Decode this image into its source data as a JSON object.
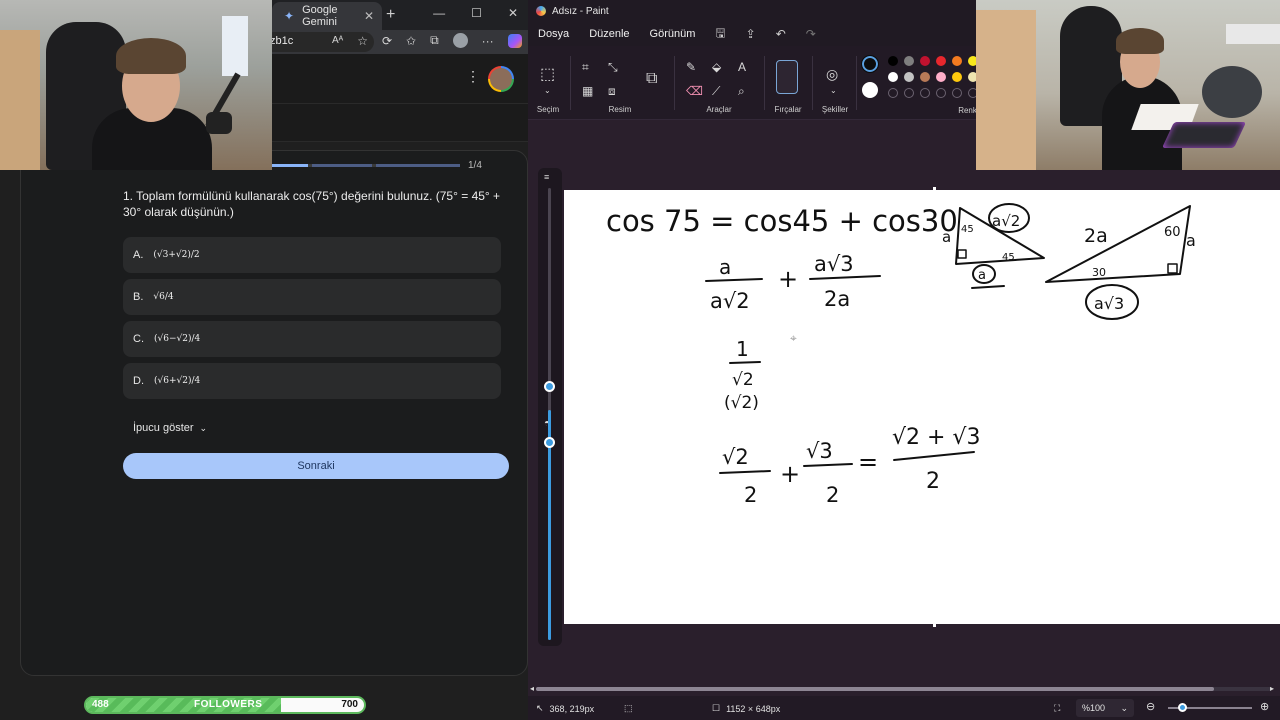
{
  "browser": {
    "tab_title": "Google Gemini",
    "tab_close": "✕",
    "new_tab": "+",
    "url_fragment": "zb1c",
    "menu_icon": "more-vert-icon"
  },
  "quiz": {
    "progress": "1/4",
    "question": "1. Toplam formülünü kullanarak cos(75°) değerini bulunuz. (75° = 45° + 30° olarak düşünün.)",
    "options": [
      {
        "letter": "A.",
        "formula": "(√3+√2)/2"
      },
      {
        "letter": "B.",
        "formula": "√6/4"
      },
      {
        "letter": "C.",
        "formula": "(√6−√2)/4"
      },
      {
        "letter": "D.",
        "formula": "(√6+√2)/4"
      }
    ],
    "hint_label": "İpucu göster",
    "next_label": "Sonraki"
  },
  "followers": {
    "current": "488",
    "label": "FOLLOWERS",
    "goal": "700",
    "progress_fraction": 0.7
  },
  "paint": {
    "window_title": "Adsız - Paint",
    "menu": [
      "Dosya",
      "Düzenle",
      "Görünüm"
    ],
    "groups": {
      "selection": "Seçim",
      "image": "Resim",
      "tools": "Araçlar",
      "brushes": "Fırçalar",
      "shapes": "Şekiller",
      "colors": "Renkler"
    },
    "palette": [
      "#000000",
      "#7f7f7f",
      "#c0122f",
      "#e8272d",
      "#f47b20",
      "#f8e71c",
      "#ffffff",
      "#c3c3c3",
      "#b97a57",
      "#ffaec9",
      "#ffc90e",
      "#efe4b0"
    ],
    "status": {
      "cursor": "368, 219px",
      "canvas_size": "1152 × 648px",
      "zoom": "%100"
    }
  },
  "drawing": {
    "line1": "cos 75 = cos45 + cos30",
    "tri1_angle1": "45",
    "tri1_angle2": "45",
    "tri1_side": "a",
    "tri1_hyp": "a√2",
    "tri1_base": "a",
    "tri2_hyp": "2a",
    "tri2_angle_top": "60",
    "tri2_angle_bottom": "30",
    "tri2_side": "a",
    "tri2_base": "a√3",
    "frac1_num": "a",
    "frac1_den": "a√2",
    "frac2_num": "a√3",
    "frac2_den": "2a",
    "mid_num": "1",
    "mid_den": "√2",
    "mid_mult": "(√2)",
    "final_lhs1_num": "√2",
    "final_lhs1_den": "2",
    "final_lhs2_num": "√3",
    "final_lhs2_den": "2",
    "final_rhs_num": "√2 + √3",
    "final_rhs_den": "2"
  }
}
